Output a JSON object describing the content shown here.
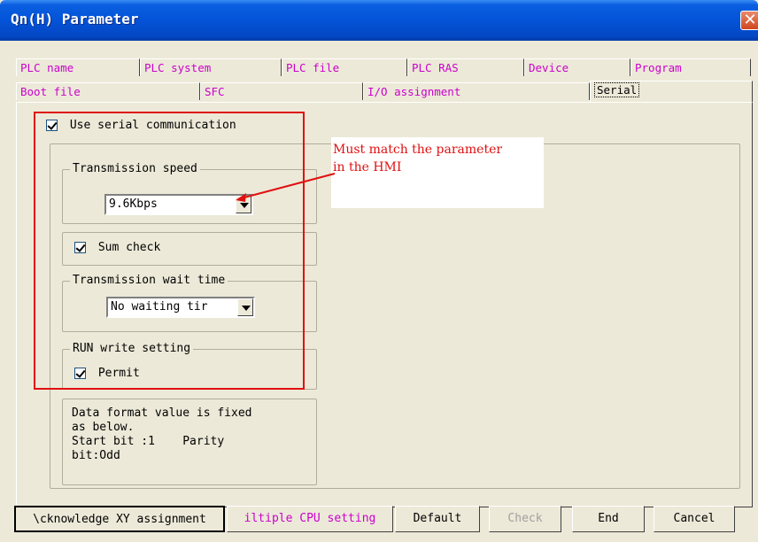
{
  "window": {
    "title": "Qn(H) Parameter",
    "close_glyph": "✕"
  },
  "tabs": {
    "row1": [
      "PLC name",
      "PLC system",
      "PLC file",
      "PLC RAS",
      "Device",
      "Program"
    ],
    "row2": [
      "Boot file",
      "SFC",
      "I/O assignment",
      "Serial"
    ],
    "active": "Serial"
  },
  "serial": {
    "use_serial_label": "Use serial communication",
    "use_serial_checked": true,
    "speed_legend": "Transmission speed",
    "speed_value": "9.6Kbps",
    "sum_check_label": "Sum check",
    "sum_check_checked": true,
    "wait_legend": "Transmission wait time",
    "wait_value": "No waiting tir",
    "run_write_legend": "RUN write setting",
    "permit_label": "Permit",
    "permit_checked": true,
    "data_format_text": "Data format value is fixed\nas below.\nStart bit :1    Parity\nbit:Odd"
  },
  "annotation": {
    "text_line1": "Must match the parameter",
    "text_line2": "in the HMI",
    "color": "#e01010"
  },
  "buttons": {
    "acknowledge": "\\cknowledge XY assignment",
    "multiple_cpu": "iltiple CPU setting",
    "default": "Default",
    "check": "Check",
    "end": "End",
    "cancel": "Cancel"
  },
  "colors": {
    "title_bar": "#0453d8",
    "tab_text": "#cc00cc",
    "highlight_box": "#e01010",
    "dialog_bg": "#ece9d8"
  }
}
